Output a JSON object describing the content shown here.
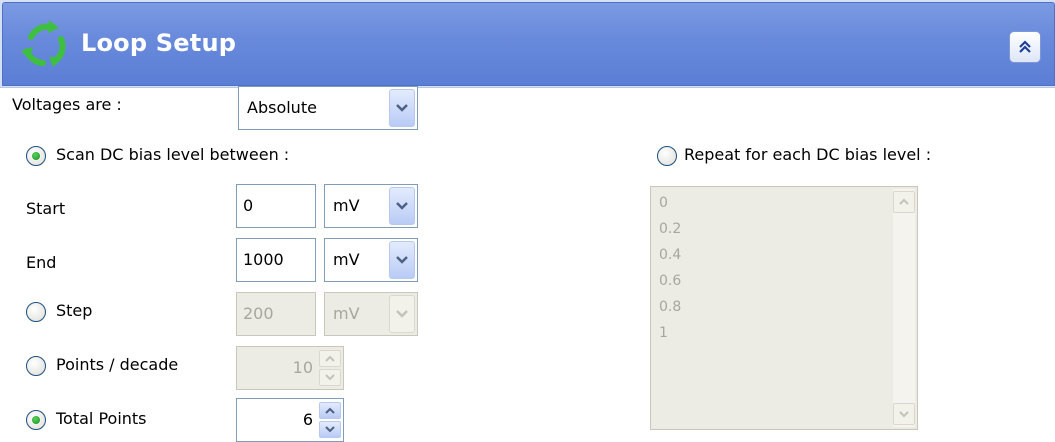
{
  "header": {
    "title": "Loop Setup",
    "icon": "loop-arrows-icon",
    "collapse_icon": "double-chevron-up-icon"
  },
  "voltages": {
    "label": "Voltages are :",
    "value": "Absolute"
  },
  "scan": {
    "label": "Scan DC bias level between :",
    "selected": true
  },
  "repeat": {
    "label": "Repeat for each DC bias level :",
    "selected": false
  },
  "start": {
    "label": "Start",
    "value": "0",
    "unit": "mV"
  },
  "end": {
    "label": "End",
    "value": "1000",
    "unit": "mV"
  },
  "step": {
    "label": "Step",
    "value": "200",
    "unit": "mV",
    "selected": false
  },
  "points_per_decade": {
    "label": "Points / decade",
    "value": "10",
    "selected": false
  },
  "total_points": {
    "label": "Total Points",
    "value": "6",
    "selected": true
  },
  "repeat_levels": [
    "0",
    "0.2",
    "0.4",
    "0.6",
    "0.8",
    "1"
  ],
  "colors": {
    "header": "#6a8bdc",
    "radio_selected": "#2fa035",
    "disabled_bg": "#ecebe4"
  }
}
